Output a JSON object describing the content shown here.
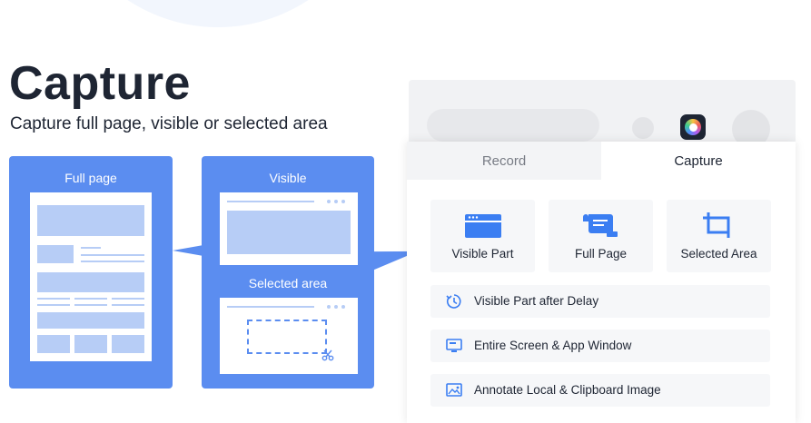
{
  "heading": {
    "title": "Capture",
    "subtitle": "Capture full page, visible or selected area"
  },
  "cards": {
    "full_page": "Full page",
    "visible": "Visible",
    "selected_area": "Selected area"
  },
  "popup": {
    "tabs": [
      {
        "label": "Record",
        "active": false
      },
      {
        "label": "Capture",
        "active": true
      }
    ],
    "tiles": [
      {
        "label": "Visible Part",
        "icon": "browser-window-icon"
      },
      {
        "label": "Full Page",
        "icon": "scroll-page-icon"
      },
      {
        "label": "Selected Area",
        "icon": "crop-icon"
      }
    ],
    "rows": [
      {
        "label": "Visible Part after Delay",
        "icon": "timer-icon"
      },
      {
        "label": "Entire Screen & App Window",
        "icon": "monitor-icon"
      },
      {
        "label": "Annotate Local & Clipboard Image",
        "icon": "image-icon"
      }
    ]
  },
  "colors": {
    "accent": "#5b8df0",
    "accent_light": "#b7cdf6",
    "text": "#1e2533",
    "icon_blue": "#3b7ef2"
  }
}
